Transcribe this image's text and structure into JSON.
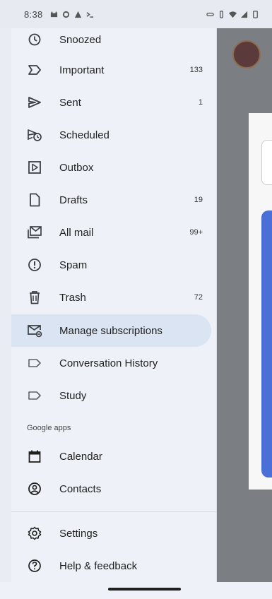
{
  "status_bar": {
    "time": "8:38"
  },
  "nav": {
    "snoozed": {
      "label": "Snoozed",
      "count": ""
    },
    "important": {
      "label": "Important",
      "count": "133"
    },
    "sent": {
      "label": "Sent",
      "count": "1"
    },
    "scheduled": {
      "label": "Scheduled",
      "count": ""
    },
    "outbox": {
      "label": "Outbox",
      "count": ""
    },
    "drafts": {
      "label": "Drafts",
      "count": "19"
    },
    "all_mail": {
      "label": "All mail",
      "count": "99+"
    },
    "spam": {
      "label": "Spam",
      "count": ""
    },
    "trash": {
      "label": "Trash",
      "count": "72"
    },
    "manage_subscriptions": {
      "label": "Manage subscriptions",
      "count": ""
    },
    "conversation_history": {
      "label": "Conversation History",
      "count": ""
    },
    "study": {
      "label": "Study",
      "count": ""
    }
  },
  "google_apps": {
    "section_label": "Google apps",
    "calendar": "Calendar",
    "contacts": "Contacts"
  },
  "footer": {
    "settings": "Settings",
    "help": "Help & feedback"
  },
  "icons": {
    "snoozed": "clock-snooze-icon",
    "important": "label-important-icon",
    "sent": "send-icon",
    "scheduled": "schedule-send-icon",
    "outbox": "outbox-icon",
    "drafts": "draft-icon",
    "all_mail": "all-mail-icon",
    "spam": "spam-icon",
    "trash": "trash-icon",
    "manage_subscriptions": "subscriptions-icon",
    "label": "label-icon",
    "calendar": "calendar-icon",
    "contacts": "contacts-icon",
    "settings": "gear-icon",
    "help": "help-icon"
  },
  "colors": {
    "drawer_bg": "#eef1f7",
    "active_bg": "#dbe4f3",
    "scrim": "#7b7e83",
    "accent": "#4a70d7"
  }
}
